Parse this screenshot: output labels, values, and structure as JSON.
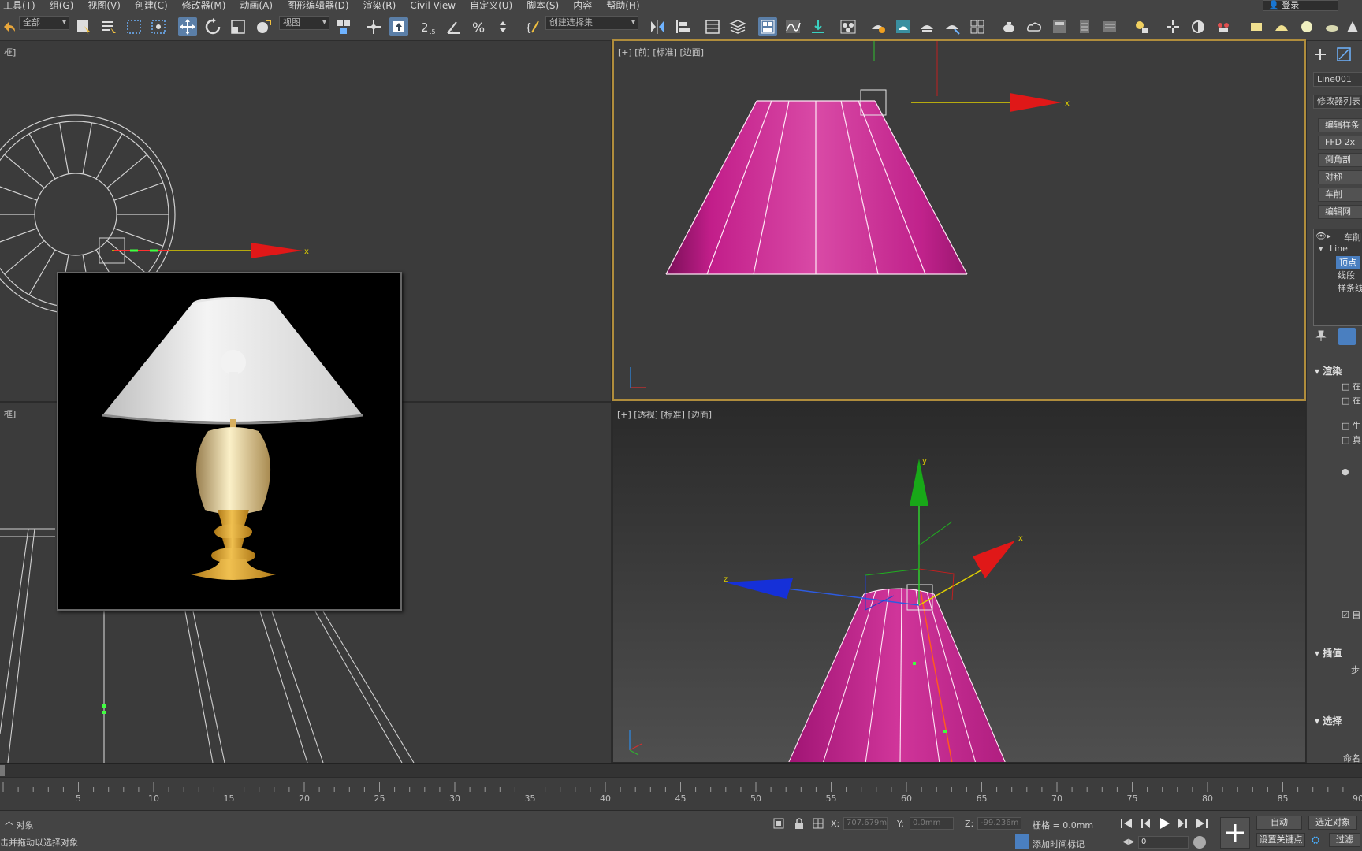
{
  "menubar": {
    "items": [
      "工具(T)",
      "组(G)",
      "视图(V)",
      "创建(C)",
      "修改器(M)",
      "动画(A)",
      "图形编辑器(D)",
      "渲染(R)",
      "Civil View",
      "自定义(U)",
      "脚本(S)",
      "内容",
      "帮助(H)"
    ],
    "login": "登录"
  },
  "toolbar": {
    "selection_filter": "全部",
    "ref_coord": "视图",
    "named_selection": "创建选择集"
  },
  "viewports": {
    "top_label": "框]",
    "front_label": "[+] [前] [标准] [边面]",
    "left_label": "框]",
    "persp_label": "[+] [透视] [标准] [边面]",
    "front_axis_x": "x",
    "top_axis_x": "x",
    "persp_axis_x": "x",
    "persp_axis_y": "y",
    "persp_axis_z": "z"
  },
  "command_panel": {
    "object_name": "Line001",
    "modifier_list": "修改器列表",
    "buttons": [
      "编辑样条",
      "FFD 2x",
      "倒角剖",
      "对称",
      "车削",
      "编辑网"
    ],
    "stack": {
      "top": "车削",
      "line": "Line",
      "sub_vertex": "顶点",
      "sub_segment": "线段",
      "sub_spline": "样条线"
    },
    "rollouts": {
      "render": "渲染",
      "render_opt1": "在",
      "render_opt2": "在",
      "render_opt3": "生",
      "render_opt4": "真",
      "auto_smooth": "自",
      "interp": "插值",
      "interp_step": "步",
      "select": "选择",
      "select_named": "命名"
    }
  },
  "timeline": {
    "ticks": [
      5,
      10,
      15,
      20,
      25,
      30,
      35,
      40,
      45,
      50,
      55,
      60,
      65,
      70,
      75,
      80,
      85,
      90
    ]
  },
  "statusbar": {
    "objects": "个 对象",
    "prompt": "击并拖动以选择对象",
    "x_label": "X:",
    "x_value": "707.679m",
    "y_label": "Y:",
    "y_value": "0.0mm",
    "z_label": "Z:",
    "z_value": "-99.236m",
    "grid": "栅格 = 0.0mm",
    "add_time_tag": "添加时间标记",
    "frame": "0",
    "auto": "自动",
    "selected": "选定对象",
    "set_key": "设置关键点",
    "filters": "过滤"
  }
}
